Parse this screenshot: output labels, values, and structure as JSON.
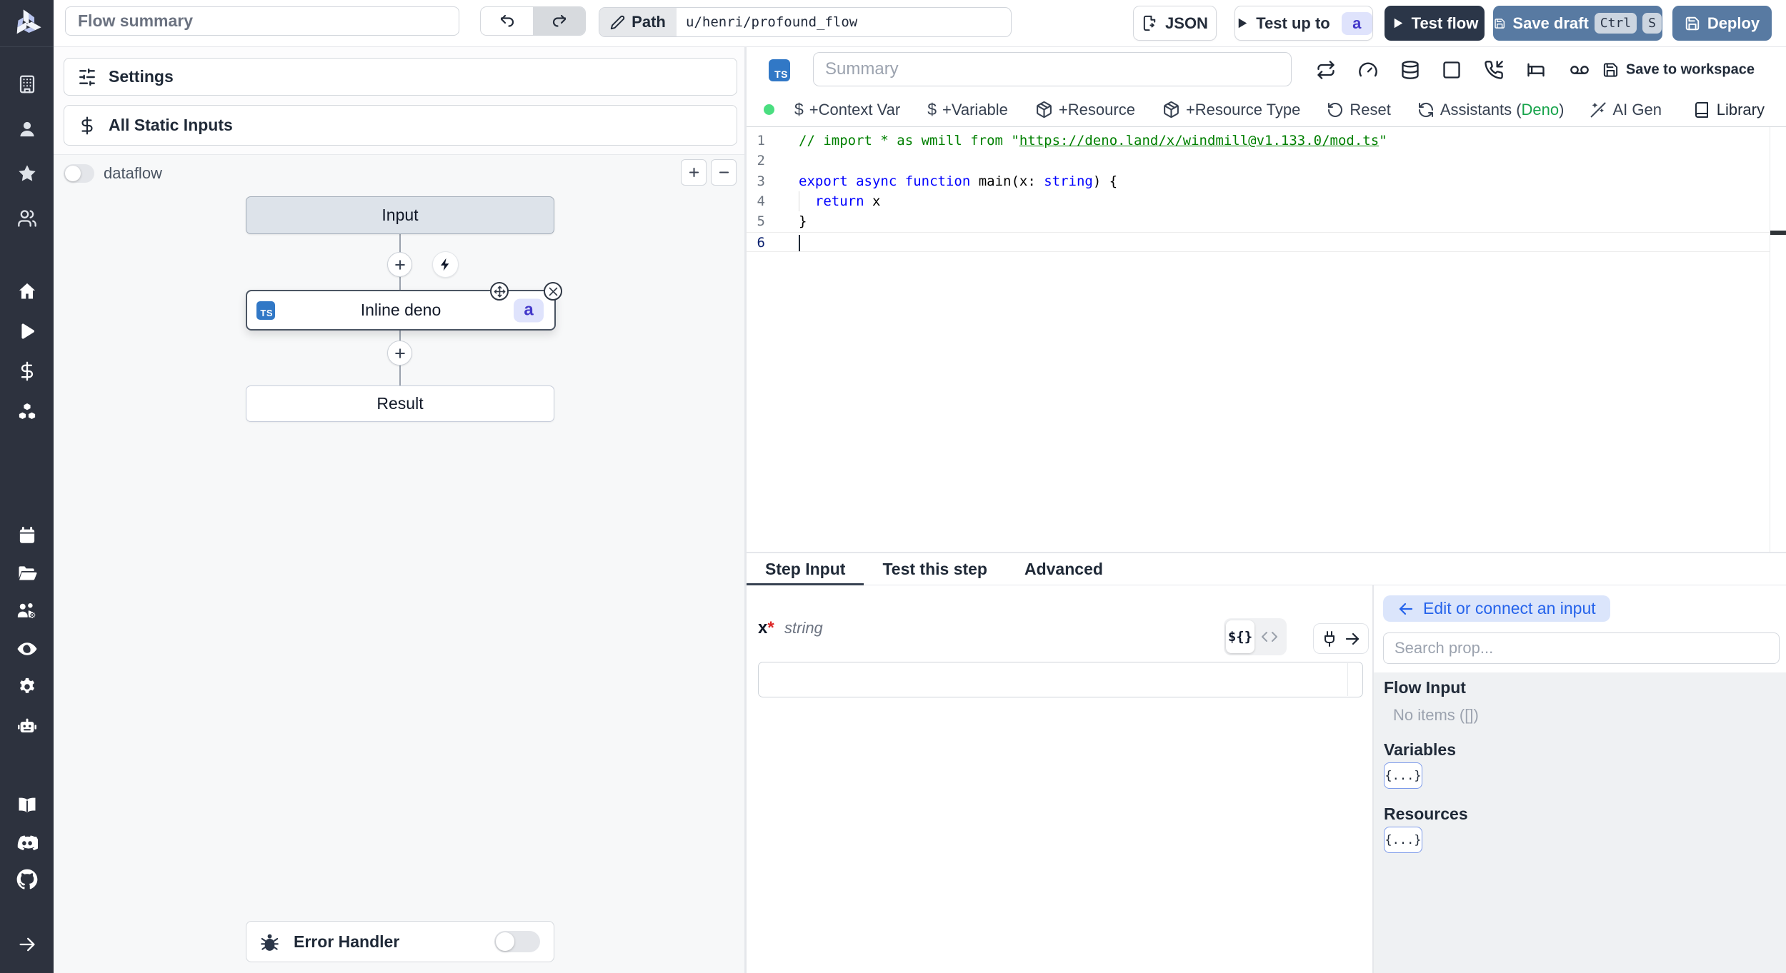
{
  "topbar": {
    "flow_summary_placeholder": "Flow summary",
    "path_label": "Path",
    "path_value": "u/henri/profound_flow",
    "json_button": "JSON",
    "test_up_to_button": "Test up to",
    "test_up_to_badge": "a",
    "test_flow_button": "Test flow",
    "save_draft_button": "Save draft",
    "save_draft_kbd_ctrl": "Ctrl",
    "save_draft_kbd_s": "S",
    "deploy_button": "Deploy"
  },
  "sidebar": {
    "icons": [
      "windmill-logo",
      "building",
      "user",
      "star",
      "users",
      "home",
      "play",
      "dollar",
      "boxes",
      "calendar",
      "folder-open",
      "users-gear",
      "eye",
      "gear",
      "bot",
      "book",
      "discord",
      "github",
      "arrow-right"
    ]
  },
  "flow_panel": {
    "settings_button": "Settings",
    "static_inputs_button": "All Static Inputs",
    "dataflow_label": "dataflow",
    "dataflow_state": "off",
    "graph": {
      "input_node": "Input",
      "step_node_language": "TS",
      "step_node_label": "Inline deno",
      "step_node_badge": "a",
      "result_node": "Result"
    },
    "error_handler_label": "Error Handler",
    "error_handler_state": "off"
  },
  "editor": {
    "language_badge": "TS",
    "summary_placeholder": "Summary",
    "header_icons": [
      "repeat",
      "gauge",
      "database",
      "square",
      "phone-incoming",
      "bed",
      "voicemail"
    ],
    "save_to_workspace": "Save to workspace",
    "status_dot_color": "#4ade80",
    "toolbar": {
      "context_var": "+Context Var",
      "variable": "+Variable",
      "resource": "+Resource",
      "resource_type": "+Resource Type",
      "reset": "Reset",
      "assistants_prefix": "Assistants (",
      "assistants_accent": "Deno",
      "assistants_suffix": ")",
      "ai_gen": "AI Gen",
      "library": "Library"
    },
    "code": {
      "language": "typescript",
      "line_numbers": [
        "1",
        "2",
        "3",
        "4",
        "5",
        "6"
      ],
      "lines": [
        {
          "tokens": [
            {
              "t": "// import * as wmill from \"",
              "c": "comment"
            },
            {
              "t": "https://deno.land/x/windmill@v1.133.0/mod.ts",
              "c": "comment-link"
            },
            {
              "t": "\"",
              "c": "comment"
            }
          ]
        },
        {
          "tokens": []
        },
        {
          "tokens": [
            {
              "t": "export",
              "c": "kw"
            },
            {
              "t": " ",
              "c": "plain"
            },
            {
              "t": "async",
              "c": "kw"
            },
            {
              "t": " ",
              "c": "plain"
            },
            {
              "t": "function",
              "c": "kw"
            },
            {
              "t": " main(x: ",
              "c": "plain"
            },
            {
              "t": "string",
              "c": "kw"
            },
            {
              "t": ") {",
              "c": "plain"
            }
          ]
        },
        {
          "tokens": [
            {
              "t": "  ",
              "c": "plain"
            },
            {
              "t": "return",
              "c": "kw"
            },
            {
              "t": " x",
              "c": "plain"
            }
          ]
        },
        {
          "tokens": [
            {
              "t": "}",
              "c": "plain"
            }
          ]
        },
        {
          "tokens": []
        }
      ]
    }
  },
  "bottom": {
    "tabs": {
      "step_input": "Step Input",
      "test_this_step": "Test this step",
      "advanced": "Advanced"
    },
    "step_input": {
      "arg_name": "x",
      "required_mark": "*",
      "arg_type": "string",
      "template_toggle": "${}",
      "code_toggle": "<>",
      "input_value": ""
    },
    "prop_picker": {
      "connect_button": "Edit or connect an input",
      "search_placeholder": "Search prop...",
      "flow_input_title": "Flow Input",
      "flow_input_empty": "No items ([])",
      "variables_title": "Variables",
      "variables_chip": "{...}",
      "resources_title": "Resources",
      "resources_chip": "{...}"
    }
  }
}
